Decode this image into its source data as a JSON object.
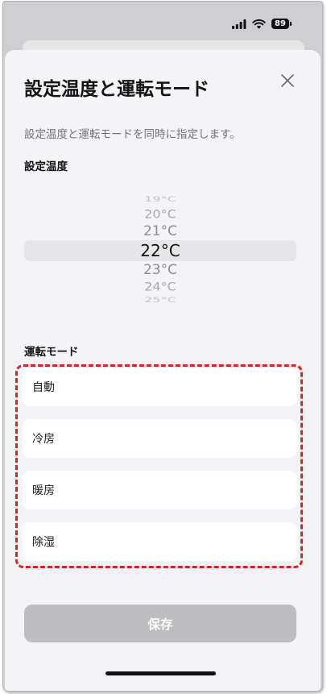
{
  "status_bar": {
    "battery": "89",
    "icons": [
      "cellular-signal-icon",
      "wifi-icon",
      "battery-icon"
    ]
  },
  "sheet": {
    "title": "設定温度と運転モード",
    "close_icon": "close-icon",
    "description": "設定温度と運転モードを同時に指定します。",
    "temperature": {
      "label": "設定温度",
      "options": [
        "19°C",
        "20°C",
        "21°C",
        "22°C",
        "23°C",
        "24°C",
        "25°C"
      ],
      "selected_index": 3
    },
    "mode": {
      "label": "運転モード",
      "options": [
        "自動",
        "冷房",
        "暖房",
        "除湿"
      ]
    },
    "save_button": {
      "label": "保存",
      "enabled": false
    }
  },
  "colors": {
    "dimmed_background": "#cfcfd1",
    "sheet_background": "#f4f4f6",
    "picker_highlight": "#e6e6e8",
    "annotation": "#e0201a",
    "save_button_disabled": "#bebec0"
  }
}
